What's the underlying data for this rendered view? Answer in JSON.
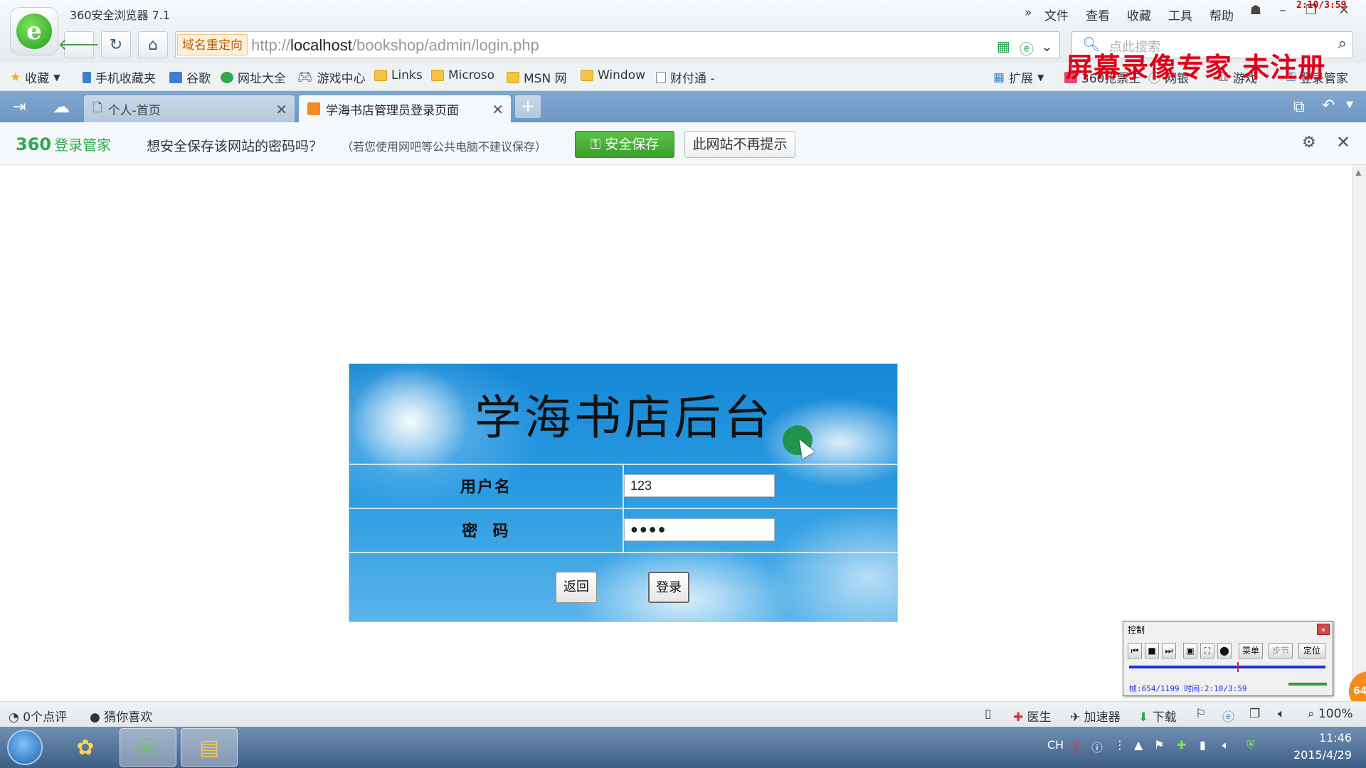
{
  "browser": {
    "app_title": "360安全浏览器 7.1",
    "menu": [
      "文件",
      "查看",
      "收藏",
      "工具",
      "帮助"
    ],
    "recording_clock": "2:10/3:59"
  },
  "address_bar": {
    "redirect_badge": "域名重定向",
    "url_scheme": "http://",
    "url_host": "localhost",
    "url_path": "/bookshop/admin/login.php",
    "search_placeholder": "点此搜索"
  },
  "watermark": "屏幕录像专家  未注册",
  "bookmarks": {
    "left": [
      "收藏",
      "手机收藏夹",
      "谷歌",
      "网址大全",
      "游戏中心",
      "Links",
      "Microso",
      "MSN 网",
      "Window",
      "财付通 -"
    ],
    "right": [
      "扩展",
      "360抢票王",
      "网银",
      "游戏",
      "登录管家"
    ]
  },
  "tabs": [
    {
      "label": "个人-首页",
      "active": false
    },
    {
      "label": "学海书店管理员登录页面",
      "active": true
    }
  ],
  "password_bar": {
    "brand": "360",
    "brand_sub": "登录管家",
    "question": "想安全保存该网站的密码吗？",
    "note": "（若您使用网吧等公共电脑不建议保存）",
    "save_label": "安全保存",
    "never_label": "此网站不再提示"
  },
  "login": {
    "title": "学海书店后台",
    "username_label": "用户名",
    "username_value": "123",
    "password_label": "密  码",
    "password_value": "●●●●",
    "back_label": "返回",
    "submit_label": "登录"
  },
  "recorder": {
    "title": "控制",
    "menu_label": "菜单",
    "step_label": "步节",
    "locate_label": "定位",
    "status": "帧:654/1199 时间:2:10/3:59",
    "progress": 0.55
  },
  "orange_badge": "64",
  "statusbar": {
    "left": [
      "0个点评",
      "猜你喜欢"
    ],
    "right": [
      "医生",
      "加速器",
      "下载",
      "100%"
    ]
  },
  "taskbar": {
    "tray_lang": "CH",
    "time": "11:46",
    "date": "2015/4/29"
  },
  "colors": {
    "accent_green": "#3a9f2b",
    "login_blue": "#1588d6",
    "watermark_red": "#e0001a"
  }
}
